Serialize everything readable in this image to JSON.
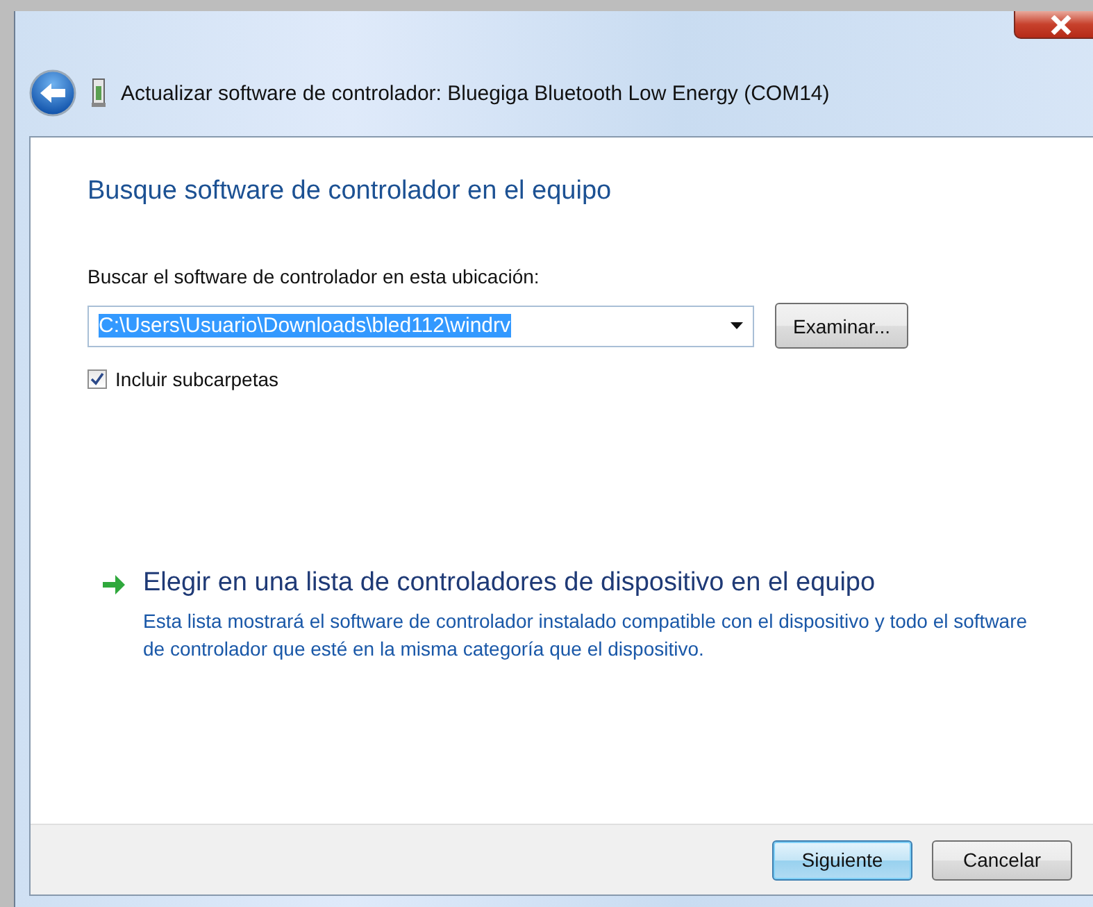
{
  "window": {
    "title": "Actualizar software de controlador: Bluegiga Bluetooth Low Energy (COM14)"
  },
  "heading": "Busque software de controlador en el equipo",
  "location": {
    "label": "Buscar el software de controlador en esta ubicación:",
    "value": "C:\\Users\\Usuario\\Downloads\\bled112\\windrv",
    "selected": true,
    "browse_button": "Examinar..."
  },
  "include_subfolders": {
    "label": "Incluir subcarpetas",
    "checked": true
  },
  "option": {
    "title": "Elegir en una lista de controladores de dispositivo en el equipo",
    "description": "Esta lista mostrará el software de controlador instalado compatible con el dispositivo y todo el software de controlador que esté en la misma categoría que el dispositivo."
  },
  "buttons": [
    {
      "label": "Siguiente",
      "default": true
    },
    {
      "label": "Cancelar",
      "default": false
    }
  ]
}
